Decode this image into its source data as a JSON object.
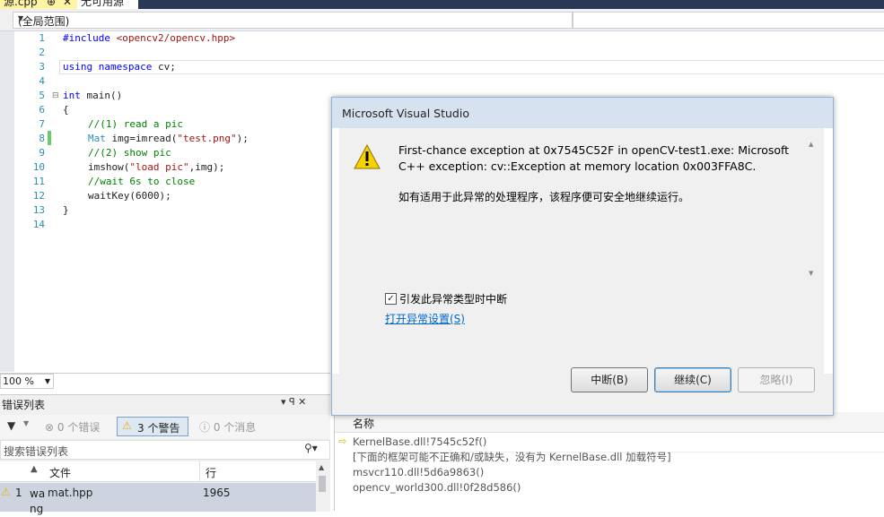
{
  "tabs": {
    "active_label": "源.cpp",
    "pin": "⊕",
    "close": "✕",
    "second_label": "无可用源"
  },
  "scope": {
    "value": "(全局范围)"
  },
  "editor": {
    "lines": [
      "1",
      "2",
      "3",
      "4",
      "5",
      "6",
      "7",
      "8",
      "9",
      "10",
      "11",
      "12",
      "13",
      "14"
    ],
    "code": {
      "l1_kw": "#include",
      "l1_str": "<opencv2/opencv.hpp>",
      "l3_kw": "using namespace",
      "l3_rest": " cv;",
      "l5_kw": "int",
      "l5_rest": " main()",
      "l6": "{",
      "l7": "//(1) read a pic",
      "l8_ty": "Mat",
      "l8_rest": " img=imread(",
      "l8_str": "\"test.png\"",
      "l8_end": ");",
      "l9": "//(2) show pic",
      "l10_a": "imshow(",
      "l10_str": "\"load pic\"",
      "l10_end": ",img);",
      "l11": "//wait 6s to close",
      "l12": "waitKey(6000);",
      "l13": "}"
    },
    "zoom": "100 %"
  },
  "error_list": {
    "title": "错误列表",
    "title_icons": "▾ ꟼ ✕",
    "filter_icon": "▼",
    "errors": "0 个错误",
    "warnings": "3 个警告",
    "messages": "0 个消息",
    "search_placeholder": "搜索错误列表",
    "col_file": "文件",
    "col_line": "行",
    "rows": [
      {
        "num": "1",
        "desc": "wa ng",
        "file": "mat.hpp",
        "line": "1965"
      }
    ]
  },
  "call_stack": {
    "col_name": "名称",
    "rows": [
      "KernelBase.dll!7545c52f()",
      "[下面的框架可能不正确和/或缺失，没有为 KernelBase.dll 加载符号]",
      "msvcr110.dll!5d6a9863()",
      "opencv_world300.dll!0f28d586()"
    ]
  },
  "dialog": {
    "title": "Microsoft Visual Studio",
    "message": "First-chance exception at 0x7545C52F in openCV-test1.exe: Microsoft C++ exception: cv::Exception at memory location 0x003FFA8C.",
    "message2": "如有适用于此异常的处理程序，该程序便可安全地继续运行。",
    "checkbox_label": "引发此异常类型时中断",
    "checkbox_checked": true,
    "link": "打开异常设置(S)",
    "btn_break": "中断(B)",
    "btn_continue": "继续(C)",
    "btn_ignore": "忽略(I)"
  }
}
